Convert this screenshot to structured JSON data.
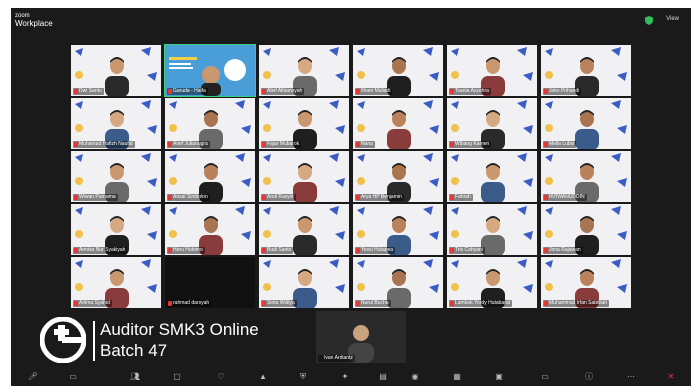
{
  "app": {
    "brand_top": "zoom",
    "brand_bottom": "Workplace",
    "view_label": "View"
  },
  "overlay": {
    "title": "Auditor SMK3 Online",
    "subtitle": "Batch 47"
  },
  "colors": {
    "window_bg": "#1a1a1a",
    "active_speaker": "#3ad07a",
    "muted": "#e33333",
    "tile_bg": "#f1f1f4"
  },
  "participants": [
    {
      "name": "Dwi Santo",
      "type": "person"
    },
    {
      "name": "Garuda - Haifa",
      "type": "presentation"
    },
    {
      "name": "Alief Albiansyah",
      "type": "person"
    },
    {
      "name": "Ilham Muliadi",
      "type": "person"
    },
    {
      "name": "Tsania Azzahra",
      "type": "person"
    },
    {
      "name": "Joko Prihandi",
      "type": "person"
    },
    {
      "name": "Muhamad Hafizh Naufal",
      "type": "person"
    },
    {
      "name": "Arief Julianugra",
      "type": "person"
    },
    {
      "name": "Fajar Mubarok",
      "type": "person"
    },
    {
      "name": "Nana",
      "type": "person"
    },
    {
      "name": "Wibang Kamen",
      "type": "person"
    },
    {
      "name": "Mella Lubis",
      "type": "person"
    },
    {
      "name": "Wiwan Purnama",
      "type": "person"
    },
    {
      "name": "Arisal Simbolon",
      "type": "person"
    },
    {
      "name": "Andi Rasyid",
      "type": "person"
    },
    {
      "name": "Arya HP Benjamin",
      "type": "person"
    },
    {
      "name": "Fahrah",
      "type": "person"
    },
    {
      "name": "IKHWANUDDIN",
      "type": "person"
    },
    {
      "name": "Annisa Nur Syakiyah",
      "type": "person"
    },
    {
      "name": "Heru Hutomo",
      "type": "person"
    },
    {
      "name": "Budi Santo",
      "type": "person"
    },
    {
      "name": "Yessi Hutapea",
      "type": "person"
    },
    {
      "name": "Tris Cahyani",
      "type": "person"
    },
    {
      "name": "Jona Rajawan",
      "type": "person"
    },
    {
      "name": "Arilma Syahid",
      "type": "person"
    },
    {
      "name": "rahmad darsyah",
      "type": "dark"
    },
    {
      "name": "Sinta Widiya",
      "type": "person"
    },
    {
      "name": "Nurul Bucha",
      "type": "person"
    },
    {
      "name": "Lambok Yordy Hutabarat",
      "type": "person"
    },
    {
      "name": "Muhammad Irfan Sabililah",
      "type": "person"
    }
  ],
  "last_participant": {
    "name": "Ivan Ardiantz"
  }
}
